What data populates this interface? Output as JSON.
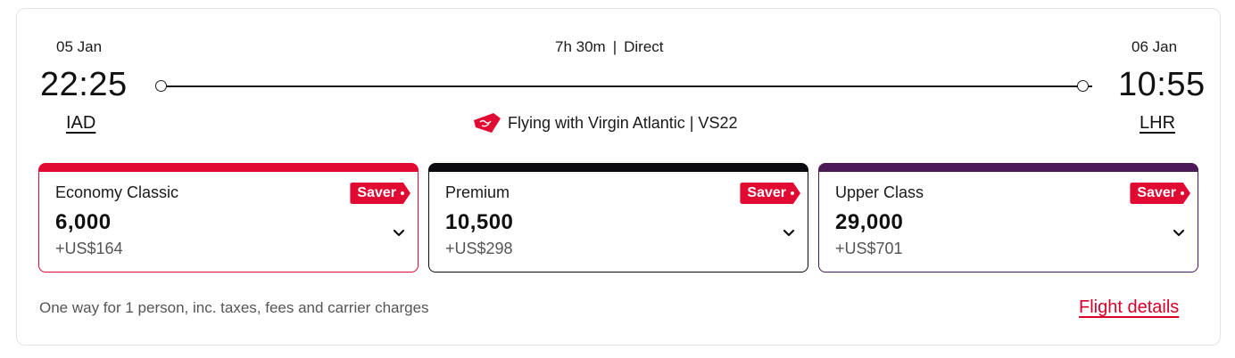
{
  "departure": {
    "date": "05 Jan",
    "time": "22:25",
    "airport": "IAD"
  },
  "arrival": {
    "date": "06 Jan",
    "time": "10:55",
    "airport": "LHR"
  },
  "duration": "7h 30m",
  "separator": "|",
  "stops": "Direct",
  "operator": {
    "text": "Flying with Virgin Atlantic | VS22",
    "logo_icon": "virgin-atlantic-logo-icon"
  },
  "fares": [
    {
      "cabin": "Economy Classic",
      "points": "6,000",
      "cash": "+US$164",
      "badge": "Saver",
      "color": "#e10a32"
    },
    {
      "cabin": "Premium",
      "points": "10,500",
      "cash": "+US$298",
      "badge": "Saver",
      "color": "#0a0a10"
    },
    {
      "cabin": "Upper Class",
      "points": "29,000",
      "cash": "+US$701",
      "badge": "Saver",
      "color": "#4c1a56"
    }
  ],
  "footnote": "One way for 1 person, inc. taxes, fees and carrier charges",
  "flight_details_link": "Flight details",
  "colors": {
    "brand_red": "#e10a32",
    "link_red": "#d6002a",
    "upper_purple": "#4c1a56",
    "premium_black": "#0a0a10"
  }
}
